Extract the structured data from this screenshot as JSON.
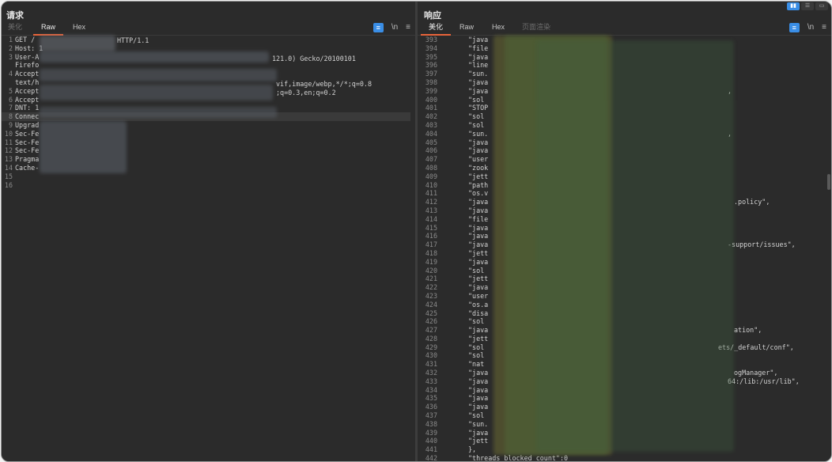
{
  "request": {
    "title": "请求",
    "tabs": [
      {
        "label": "美化",
        "state": "dim"
      },
      {
        "label": "Raw",
        "state": "active"
      },
      {
        "label": "Hex",
        "state": "normal"
      }
    ],
    "tools": {
      "wrap": "≡",
      "newline": "\\n",
      "menu": "≡"
    },
    "line_numbers": [
      "1",
      "2",
      "3",
      "",
      "4",
      "",
      "5",
      "6",
      "7",
      "8",
      "9",
      "10",
      "11",
      "12",
      "13",
      "14",
      "15",
      "16"
    ],
    "lines": [
      "GET /",
      "Host: 1",
      "User-A",
      "Firefo",
      "Accept",
      "text/h",
      "Accept",
      "Accept",
      "DNT: 1",
      "Connec",
      "Upgrad",
      "Sec-Fe",
      "Sec-Fe",
      "Sec-Fe",
      "Pragma",
      "Cache-",
      "",
      ""
    ],
    "fragments": {
      "http_version": "HTTP/1.1",
      "user_agent_tail": "121.0) Gecko/20100101",
      "accept_tail": "vif,image/webp,*/*;q=0.8",
      "lang_tail": ";q=0.3,en;q=0.2"
    }
  },
  "response": {
    "title": "响应",
    "tabs": [
      {
        "label": "美化",
        "state": "active"
      },
      {
        "label": "Raw",
        "state": "normal"
      },
      {
        "label": "Hex",
        "state": "normal"
      },
      {
        "label": "页面渲染",
        "state": "dim"
      }
    ],
    "layout_buttons": [
      "▮▮",
      "☰",
      "▭"
    ],
    "tools": {
      "wrap": "≡",
      "newline": "\\n",
      "menu": "≡"
    },
    "line_numbers": [
      "393",
      "394",
      "395",
      "396",
      "397",
      "398",
      "399",
      "400",
      "401",
      "402",
      "403",
      "404",
      "405",
      "406",
      "407",
      "408",
      "409",
      "410",
      "411",
      "412",
      "413",
      "414",
      "415",
      "416",
      "417",
      "418",
      "419",
      "420",
      "421",
      "422",
      "423",
      "424",
      "425",
      "426",
      "427",
      "428",
      "429",
      "430",
      "431",
      "432",
      "433",
      "434",
      "435",
      "436",
      "437",
      "438",
      "439",
      "440",
      "441",
      "442"
    ],
    "lines": [
      "\"java",
      "\"file",
      "\"java",
      "\"line",
      "\"sun.",
      "\"java",
      "\"java",
      "\"sol",
      "\"STOP",
      "\"sol",
      "\"sol",
      "\"sun.",
      "\"java",
      "\"java",
      "\"user",
      "\"zook",
      "\"jett",
      "\"path",
      "\"os.v",
      "\"java",
      "\"java",
      "\"file",
      "\"java",
      "\"java",
      "\"java",
      "\"jett",
      "\"java",
      "\"sol",
      "\"jett",
      "\"java",
      "\"user",
      "\"os.a",
      "\"disa",
      "\"sol",
      "\"java",
      "\"jett",
      "\"sol",
      "\"sol",
      "\"nat",
      "\"java",
      "\"java",
      "\"java",
      "\"java",
      "\"java",
      "\"sol",
      "\"sun.",
      "\"java",
      "\"jett",
      "},",
      "\"threads_blocked_count\":0"
    ],
    "tails": [
      {
        "line": 399,
        "text": ","
      },
      {
        "line": 404,
        "text": ","
      },
      {
        "line": 412,
        "text": ".policy\","
      },
      {
        "line": 417,
        "text": "-support/issues\","
      },
      {
        "line": 427,
        "text": "ation\","
      },
      {
        "line": 429,
        "text": "ets/_default/conf\","
      },
      {
        "line": 432,
        "text": "ogManager\","
      },
      {
        "line": 433,
        "text": "64:/lib:/usr/lib\","
      }
    ]
  }
}
